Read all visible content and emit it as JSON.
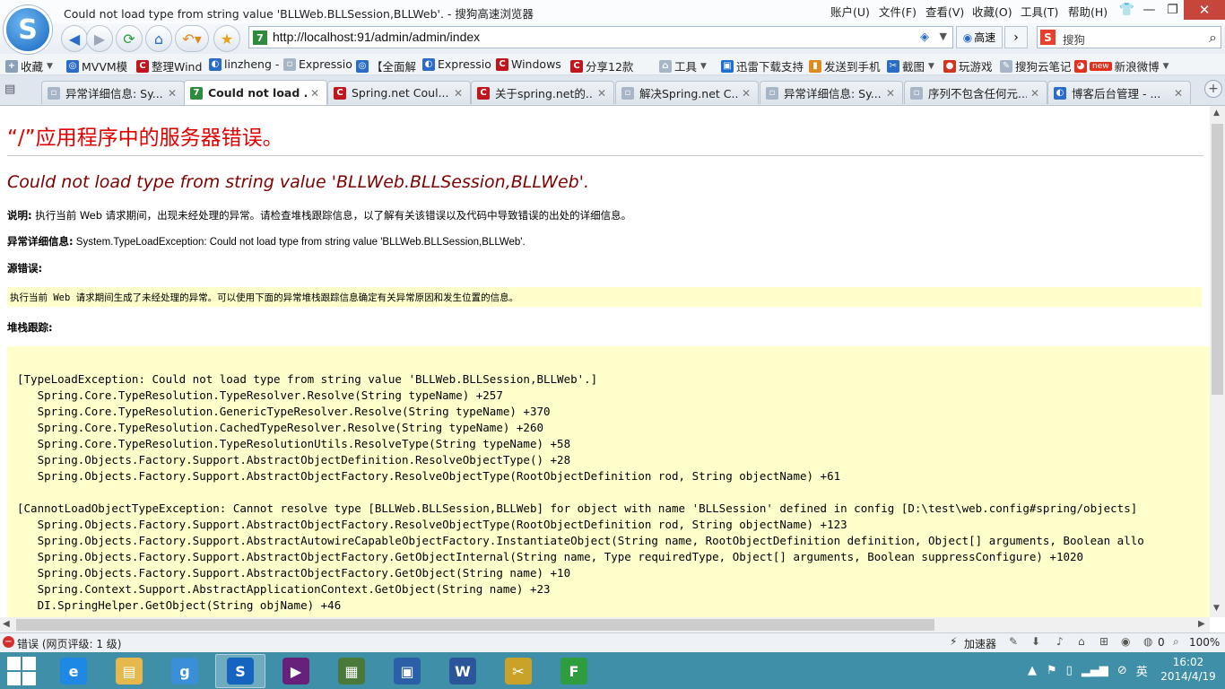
{
  "window": {
    "title": "Could not load type from string value 'BLLWeb.BLLSession,BLLWeb'. - 搜狗高速浏览器",
    "menu": [
      "账户(U)",
      "文件(F)",
      "查看(V)",
      "收藏(O)",
      "工具(T)",
      "帮助(H)"
    ]
  },
  "nav": {
    "address": "http://localhost:91/admin/admin/index",
    "speed_label": "高速",
    "search_placeholder": "搜狗"
  },
  "bookmarks": [
    {
      "label": "收藏",
      "icon": "star-icon",
      "color": "#e8a317"
    },
    {
      "label": "MVVM模",
      "icon": "globe-icon",
      "color": "#2a6cc8"
    },
    {
      "label": "整理Wind",
      "icon": "c-logo-icon",
      "color": "#c0161d"
    },
    {
      "label": "linzheng -",
      "icon": "blog-icon",
      "color": "#2a6cc8"
    },
    {
      "label": "Expressio",
      "icon": "page-icon",
      "color": "#7a8ca0"
    },
    {
      "label": "【全面解",
      "icon": "globe-icon",
      "color": "#2a6cc8"
    },
    {
      "label": "Expressio",
      "icon": "blog-icon",
      "color": "#2a6cc8"
    },
    {
      "label": "Windows",
      "icon": "c-logo-icon",
      "color": "#c0161d"
    },
    {
      "label": "分享12款",
      "icon": "c-logo-icon",
      "color": "#c0161d"
    },
    {
      "label": "工具",
      "icon": "tools-icon",
      "color": "#7a8ca0"
    },
    {
      "label": "迅雷下载支持",
      "icon": "thunder-icon",
      "color": "#1e6fd0"
    },
    {
      "label": "发送到手机",
      "icon": "phone-icon",
      "color": "#e08a1e"
    },
    {
      "label": "截图",
      "icon": "scissors-icon",
      "color": "#2a6cc8"
    },
    {
      "label": "玩游戏",
      "icon": "game-icon",
      "color": "#d0341e"
    },
    {
      "label": "搜狗云笔记",
      "icon": "note-icon",
      "color": "#7a8ca0"
    },
    {
      "label": "新浪微博",
      "icon": "weibo-icon",
      "color": "#e0301e",
      "badge": "new"
    }
  ],
  "tabs": [
    {
      "label": "异常详细信息: Sy...",
      "icon": "page-icon",
      "color": "#7a8ca0"
    },
    {
      "label": "Could not load ...",
      "icon": "seven-icon",
      "color": "#2e8b3c",
      "active": true
    },
    {
      "label": "Spring.net Coul...",
      "icon": "c-logo-icon",
      "color": "#c0161d"
    },
    {
      "label": "关于spring.net的...",
      "icon": "c-logo-icon",
      "color": "#c0161d"
    },
    {
      "label": "解决Spring.net C...",
      "icon": "page-icon",
      "color": "#7a8ca0"
    },
    {
      "label": "异常详细信息: Sy...",
      "icon": "page-icon",
      "color": "#7a8ca0"
    },
    {
      "label": "序列不包含任何元...",
      "icon": "page-icon",
      "color": "#7a8ca0"
    },
    {
      "label": "博客后台管理 - ...",
      "icon": "blog-icon",
      "color": "#2a6cc8"
    }
  ],
  "page": {
    "heading": "“/”应用程序中的服务器错误。",
    "error_title": "Could not load type from string value 'BLLWeb.BLLSession,BLLWeb'.",
    "desc_label": "说明:",
    "desc_text": " 执行当前 Web 请求期间，出现未经处理的异常。请检查堆栈跟踪信息，以了解有关该错误以及代码中导致错误的出处的详细信息。",
    "exc_label": "异常详细信息:",
    "exc_text": " System.TypeLoadException: Could not load type from string value 'BLLWeb.BLLSession,BLLWeb'.",
    "src_label": "源错误:",
    "src_text": "执行当前 Web 请求期间生成了未经处理的异常。可以使用下面的异常堆栈跟踪信息确定有关异常原因和发生位置的信息。",
    "stack_label": "堆栈跟踪:",
    "stack_lines": [
      "[TypeLoadException: Could not load type from string value 'BLLWeb.BLLSession,BLLWeb'.]",
      "   Spring.Core.TypeResolution.TypeResolver.Resolve(String typeName) +257",
      "   Spring.Core.TypeResolution.GenericTypeResolver.Resolve(String typeName) +370",
      "   Spring.Core.TypeResolution.CachedTypeResolver.Resolve(String typeName) +260",
      "   Spring.Core.TypeResolution.TypeResolutionUtils.ResolveType(String typeName) +58",
      "   Spring.Objects.Factory.Support.AbstractObjectDefinition.ResolveObjectType() +28",
      "   Spring.Objects.Factory.Support.AbstractObjectFactory.ResolveObjectType(RootObjectDefinition rod, String objectName) +61",
      "",
      "[CannotLoadObjectTypeException: Cannot resolve type [BLLWeb.BLLSession,BLLWeb] for object with name 'BLLSession' defined in config [D:\\test\\web.config#spring/objects]",
      "   Spring.Objects.Factory.Support.AbstractObjectFactory.ResolveObjectType(RootObjectDefinition rod, String objectName) +123",
      "   Spring.Objects.Factory.Support.AbstractAutowireCapableObjectFactory.InstantiateObject(String name, RootObjectDefinition definition, Object[] arguments, Boolean allo",
      "   Spring.Objects.Factory.Support.AbstractObjectFactory.GetObjectInternal(String name, Type requiredType, Object[] arguments, Boolean suppressConfigure) +1020",
      "   Spring.Objects.Factory.Support.AbstractObjectFactory.GetObject(String name) +10",
      "   Spring.Context.Support.AbstractApplicationContext.GetObject(String name) +23",
      "   DI.SpringHelper.GetObject(String objName) +46"
    ]
  },
  "status": {
    "error_text": "错误 (网页评级: 1 级)",
    "accelerator": "加速器",
    "count": "0",
    "zoom": "100%"
  },
  "taskbar": {
    "apps": [
      {
        "name": "ie-icon",
        "color": "#1e88e5",
        "glyph": "e"
      },
      {
        "name": "explorer-icon",
        "color": "#e5b84c",
        "glyph": "▤"
      },
      {
        "name": "pinyin-icon",
        "color": "#3a8fd8",
        "glyph": "g"
      },
      {
        "name": "sogou-browser-icon",
        "color": "#1565c0",
        "glyph": "S",
        "active": true
      },
      {
        "name": "visual-studio-icon",
        "color": "#68217a",
        "glyph": "▶"
      },
      {
        "name": "installer-icon",
        "color": "#4a7a3a",
        "glyph": "▦"
      },
      {
        "name": "remote-desktop-icon",
        "color": "#2b5fa8",
        "glyph": "▣"
      },
      {
        "name": "word-icon",
        "color": "#2b579a",
        "glyph": "W"
      },
      {
        "name": "tools-app-icon",
        "color": "#c9a227",
        "glyph": "✂"
      },
      {
        "name": "green-app-icon",
        "color": "#2e9d3f",
        "glyph": "F"
      }
    ],
    "lang": "英",
    "time": "16:02",
    "date": "2014/4/19"
  }
}
